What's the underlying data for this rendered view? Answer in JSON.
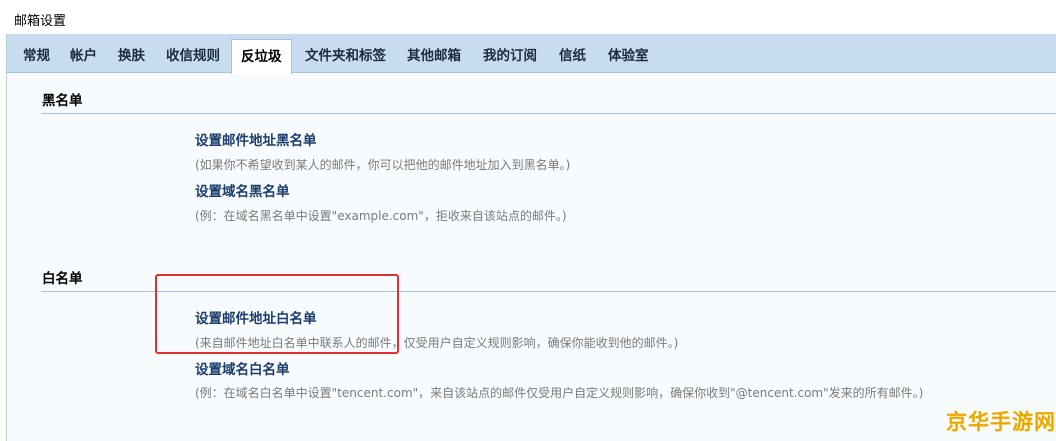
{
  "page": {
    "title": "邮箱设置"
  },
  "tabs": [
    {
      "label": "常规",
      "active": false
    },
    {
      "label": "帐户",
      "active": false
    },
    {
      "label": "换肤",
      "active": false
    },
    {
      "label": "收信规则",
      "active": false
    },
    {
      "label": "反垃圾",
      "active": true
    },
    {
      "label": "文件夹和标签",
      "active": false
    },
    {
      "label": "其他邮箱",
      "active": false
    },
    {
      "label": "我的订阅",
      "active": false
    },
    {
      "label": "信纸",
      "active": false
    },
    {
      "label": "体验室",
      "active": false
    }
  ],
  "blacklist": {
    "title": "黑名单",
    "address_link": "设置邮件地址黑名单",
    "address_hint": "(如果你不希望收到某人的邮件，你可以把他的邮件地址加入到黑名单。)",
    "domain_link": "设置域名黑名单",
    "domain_hint": "(例：在域名黑名单中设置\"example.com\"，拒收来自该站点的邮件。)"
  },
  "whitelist": {
    "title": "白名单",
    "address_link": "设置邮件地址白名单",
    "address_hint": "(来自邮件地址白名单中联系人的邮件，仅受用户自定义规则影响，确保你能收到他的邮件。)",
    "domain_link": "设置域名白名单",
    "domain_hint": "(例：在域名白名单中设置\"tencent.com\"，来自该站点的邮件仅受用户自定义规则影响，确保你收到\"@tencent.com\"发来的所有邮件。)"
  },
  "watermark": {
    "text": "京华手游网"
  },
  "colors": {
    "tabbar_bg": "#c8dcf0",
    "link": "#1b3e6c",
    "hint": "#7a7a7a",
    "highlight_box": "#e03030",
    "watermark": "#e8a800"
  }
}
